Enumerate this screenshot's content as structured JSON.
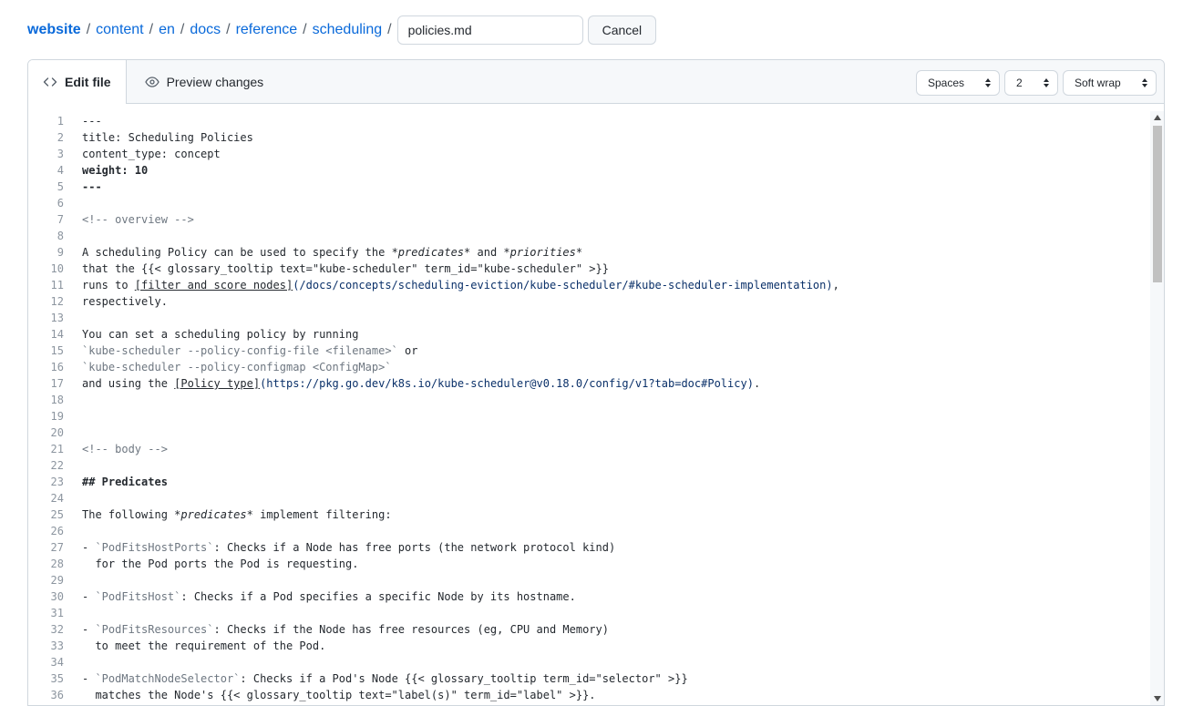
{
  "breadcrumb": {
    "root": "website",
    "segments": [
      "content",
      "en",
      "docs",
      "reference",
      "scheduling"
    ],
    "separator": "/"
  },
  "filename": {
    "value": "policies.md"
  },
  "cancel_label": "Cancel",
  "tabs": {
    "edit": "Edit file",
    "preview": "Preview changes"
  },
  "controls": {
    "indent_mode": "Spaces",
    "indent_size": "2",
    "wrap_mode": "Soft wrap"
  },
  "colors": {
    "link": "#0969da",
    "border": "#d0d7de",
    "header_bg": "#f6f8fa"
  },
  "code_lines": [
    "---",
    "title: Scheduling Policies",
    "content_type: concept",
    "weight: 10",
    "---",
    "",
    "<!-- overview -->",
    "",
    "A scheduling Policy can be used to specify the *predicates* and *priorities*",
    "that the {{< glossary_tooltip text=\"kube-scheduler\" term_id=\"kube-scheduler\" >}}",
    "runs to [filter and score nodes](/docs/concepts/scheduling-eviction/kube-scheduler/#kube-scheduler-implementation),",
    "respectively.",
    "",
    "You can set a scheduling policy by running",
    "`kube-scheduler --policy-config-file <filename>` or",
    "`kube-scheduler --policy-configmap <ConfigMap>`",
    "and using the [Policy type](https://pkg.go.dev/k8s.io/kube-scheduler@v0.18.0/config/v1?tab=doc#Policy).",
    "",
    "",
    "",
    "<!-- body -->",
    "",
    "## Predicates",
    "",
    "The following *predicates* implement filtering:",
    "",
    "- `PodFitsHostPorts`: Checks if a Node has free ports (the network protocol kind)",
    "  for the Pod ports the Pod is requesting.",
    "",
    "- `PodFitsHost`: Checks if a Pod specifies a specific Node by its hostname.",
    "",
    "- `PodFitsResources`: Checks if the Node has free resources (eg, CPU and Memory)",
    "  to meet the requirement of the Pod.",
    "",
    "- `PodMatchNodeSelector`: Checks if a Pod's Node {{< glossary_tooltip term_id=\"selector\" >}}",
    "  matches the Node's {{< glossary_tooltip text=\"label(s)\" term_id=\"label\" >}}."
  ]
}
